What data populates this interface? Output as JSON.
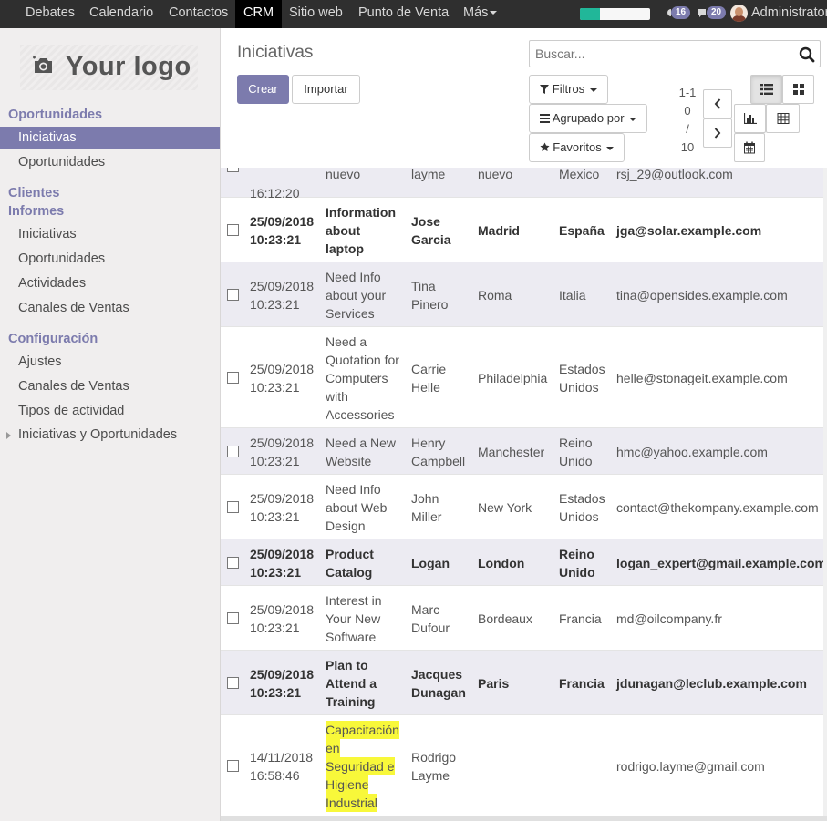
{
  "top_menu": {
    "items": [
      "Debates",
      "Calendario",
      "Contactos",
      "CRM",
      "Sitio web",
      "Punto de Venta",
      "Más"
    ],
    "active": "CRM",
    "progress_fraction": 0.28,
    "activity_count": "16",
    "messages_count": "20",
    "user_name": "Administrator"
  },
  "sidebar": {
    "logo_text": "Your logo",
    "sections": [
      {
        "header": "Oportunidades",
        "items": [
          "Iniciativas",
          "Oportunidades"
        ]
      },
      {
        "header": "Clientes",
        "items": []
      },
      {
        "header": "Informes",
        "items": [
          "Iniciativas",
          "Oportunidades",
          "Actividades",
          "Canales de Ventas"
        ]
      },
      {
        "header": "Configuración",
        "items": [
          "Ajustes",
          "Canales de Ventas",
          "Tipos de actividad",
          "Iniciativas y Oportunidades"
        ]
      }
    ],
    "active_item": "Iniciativas"
  },
  "control_panel": {
    "title": "Iniciativas",
    "create_label": "Crear",
    "import_label": "Importar",
    "search_placeholder": "Buscar...",
    "filters_label": "Filtros",
    "groupby_label": "Agrupado por",
    "favorites_label": "Favoritos",
    "pager": {
      "range": "1-10",
      "separator": "/",
      "total": "10"
    }
  },
  "colors": {
    "accent": "#7c7bad",
    "topbar": "#2f2f2f",
    "highlight": "#f8f83a",
    "progress": "#21b799"
  },
  "rows": [
    {
      "date": "",
      "time": "16:12:20",
      "name": [
        "nuevo"
      ],
      "contact": [
        "layme"
      ],
      "city": "nuevo",
      "country": [
        "Mexico"
      ],
      "email": "rsj_29@outlook.com",
      "bold": false,
      "highlight": false
    },
    {
      "date": "25/09/2018",
      "time": "10:23:21",
      "name": [
        "Information",
        "about",
        "laptop"
      ],
      "contact": [
        "Jose",
        "Garcia"
      ],
      "city": "Madrid",
      "country": [
        "España"
      ],
      "email": "jga@solar.example.com",
      "bold": true,
      "highlight": false
    },
    {
      "date": "25/09/2018",
      "time": "10:23:21",
      "name": [
        "Need Info",
        "about your",
        "Services"
      ],
      "contact": [
        "Tina",
        "Pinero"
      ],
      "city": "Roma",
      "country": [
        "Italia"
      ],
      "email": "tina@opensides.example.com",
      "bold": false,
      "highlight": false
    },
    {
      "date": "25/09/2018",
      "time": "10:23:21",
      "name": [
        "Need a",
        "Quotation for",
        "Computers",
        "with",
        "Accessories"
      ],
      "contact": [
        "Carrie",
        "Helle"
      ],
      "city": "Philadelphia",
      "country": [
        "Estados",
        "Unidos"
      ],
      "email": "helle@stonageit.example.com",
      "bold": false,
      "highlight": false
    },
    {
      "date": "25/09/2018",
      "time": "10:23:21",
      "name": [
        "Need a New",
        "Website"
      ],
      "contact": [
        "Henry",
        "Campbell"
      ],
      "city": "Manchester",
      "country": [
        "Reino",
        "Unido"
      ],
      "email": "hmc@yahoo.example.com",
      "bold": false,
      "highlight": false
    },
    {
      "date": "25/09/2018",
      "time": "10:23:21",
      "name": [
        "Need Info",
        "about Web",
        "Design"
      ],
      "contact": [
        "John",
        "Miller"
      ],
      "city": "New York",
      "country": [
        "Estados",
        "Unidos"
      ],
      "email": "contact@thekompany.example.com",
      "bold": false,
      "highlight": false
    },
    {
      "date": "25/09/2018",
      "time": "10:23:21",
      "name": [
        "Product",
        "Catalog"
      ],
      "contact": [
        "Logan"
      ],
      "city": "London",
      "country": [
        "Reino",
        "Unido"
      ],
      "email": "logan_expert@gmail.example.com",
      "bold": true,
      "highlight": false
    },
    {
      "date": "25/09/2018",
      "time": "10:23:21",
      "name": [
        "Interest in",
        "Your New",
        "Software"
      ],
      "contact": [
        "Marc",
        "Dufour"
      ],
      "city": "Bordeaux",
      "country": [
        "Francia"
      ],
      "email": "md@oilcompany.fr",
      "bold": false,
      "highlight": false
    },
    {
      "date": "25/09/2018",
      "time": "10:23:21",
      "name": [
        "Plan to",
        "Attend a",
        "Training"
      ],
      "contact": [
        "Jacques",
        "Dunagan"
      ],
      "city": "Paris",
      "country": [
        "Francia"
      ],
      "email": "jdunagan@leclub.example.com",
      "bold": true,
      "highlight": false
    },
    {
      "date": "14/11/2018",
      "time": "16:58:46",
      "name": [
        "Capacitación",
        "en",
        "Seguridad e",
        "Higiene",
        "Industrial"
      ],
      "contact": [
        "Rodrigo",
        "Layme"
      ],
      "city": "",
      "country": [],
      "email": "rodrigo.layme@gmail.com",
      "bold": false,
      "highlight": true
    }
  ]
}
